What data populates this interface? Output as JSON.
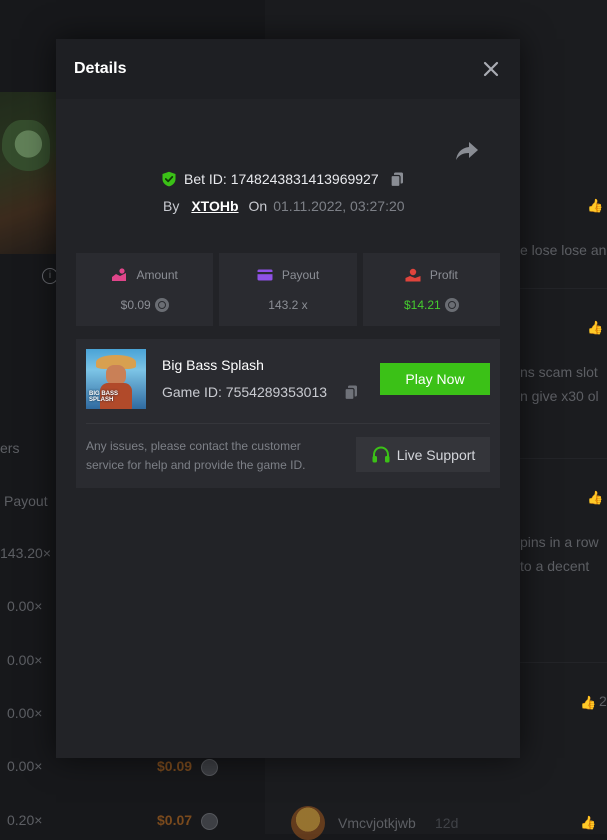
{
  "background": {
    "left_labels": [
      "ers",
      "Payout"
    ],
    "left_payouts": [
      "143.20×",
      "0.00×",
      "0.00×",
      "0.00×",
      "0.00×",
      "0.20×"
    ],
    "left_amounts": [
      "$0.09",
      "$0.07"
    ],
    "comments": [
      "e lose lose an",
      "ns scam slot",
      "n give x30 ol",
      "pins in a row",
      "to a decent"
    ],
    "bottom_user": "Vmcvjotkjwb",
    "bottom_time": "12d",
    "side_count": "2"
  },
  "modal": {
    "title": "Details",
    "bet": {
      "id_label": "Bet ID:",
      "id_value": "1748243831413969927",
      "by_label": "By",
      "username": "XTOHb",
      "on_label": "On",
      "datetime": "01.11.2022, 03:27:20"
    },
    "stats": [
      {
        "label": "Amount",
        "value": "$0.09",
        "icon": "amount-icon",
        "color": "#e0458a"
      },
      {
        "label": "Payout",
        "value": "143.2 x",
        "icon": "card-icon",
        "color": "#8f52e6"
      },
      {
        "label": "Profit",
        "value": "$14.21",
        "icon": "profit-icon",
        "color": "#e0443c"
      }
    ],
    "game": {
      "name": "Big Bass Splash",
      "id_label": "Game ID:",
      "id_value": "7554289353013",
      "thumb_text": "BIG BASS SPLASH",
      "play_label": "Play Now"
    },
    "support": {
      "text": "Any issues, please contact the customer service for help and provide the game ID.",
      "button_label": "Live Support"
    }
  },
  "colors": {
    "accent_green": "#3bc117",
    "profit_green": "#45cc2f",
    "modal_bg": "#222327",
    "card_bg": "#2a2b30"
  }
}
